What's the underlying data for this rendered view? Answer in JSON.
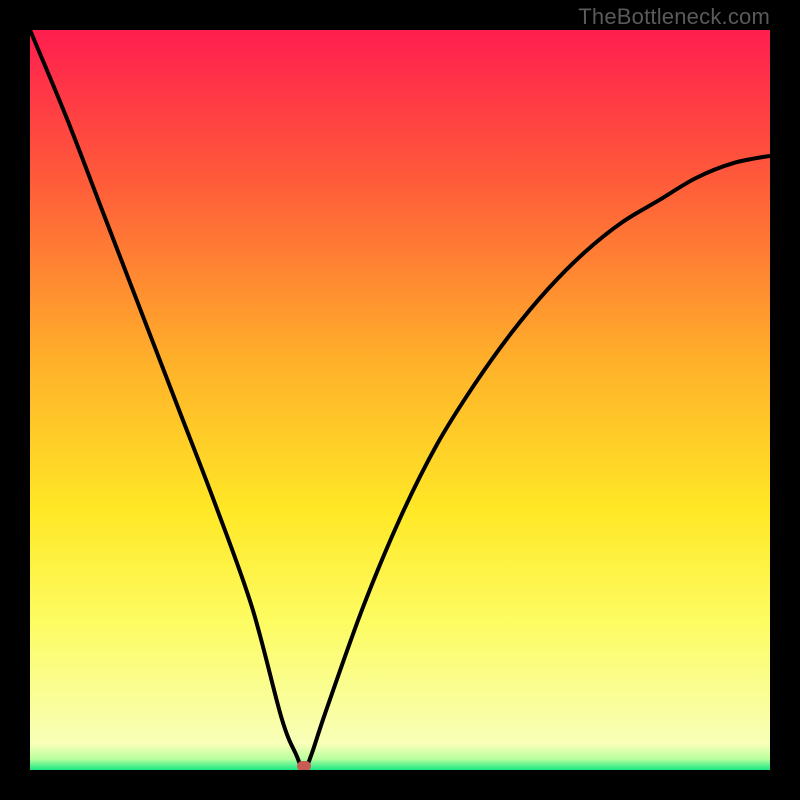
{
  "watermark": "TheBottleneck.com",
  "chart_data": {
    "type": "line",
    "title": "",
    "xlabel": "",
    "ylabel": "",
    "xlim": [
      0,
      100
    ],
    "ylim": [
      0,
      100
    ],
    "gradient_stops": [
      {
        "offset": 0.0,
        "color": "#ff1e4f"
      },
      {
        "offset": 0.2,
        "color": "#ff5a3a"
      },
      {
        "offset": 0.45,
        "color": "#ffb12a"
      },
      {
        "offset": 0.65,
        "color": "#ffe826"
      },
      {
        "offset": 0.8,
        "color": "#fdfc62"
      },
      {
        "offset": 0.965,
        "color": "#f8ffb8"
      },
      {
        "offset": 0.985,
        "color": "#b8ff9e"
      },
      {
        "offset": 1.0,
        "color": "#18e884"
      }
    ],
    "series": [
      {
        "name": "bottleneck-curve",
        "x": [
          0,
          5,
          10,
          15,
          20,
          25,
          30,
          34,
          36,
          37,
          38,
          40,
          45,
          50,
          55,
          60,
          65,
          70,
          75,
          80,
          85,
          90,
          95,
          100
        ],
        "y": [
          100,
          88,
          75,
          62,
          49,
          36,
          22,
          7,
          2,
          0,
          2,
          8,
          22,
          34,
          44,
          52,
          59,
          65,
          70,
          74,
          77,
          80,
          82,
          83
        ]
      }
    ],
    "marker": {
      "x": 37,
      "y": 0.5,
      "color": "#c85b53"
    }
  }
}
